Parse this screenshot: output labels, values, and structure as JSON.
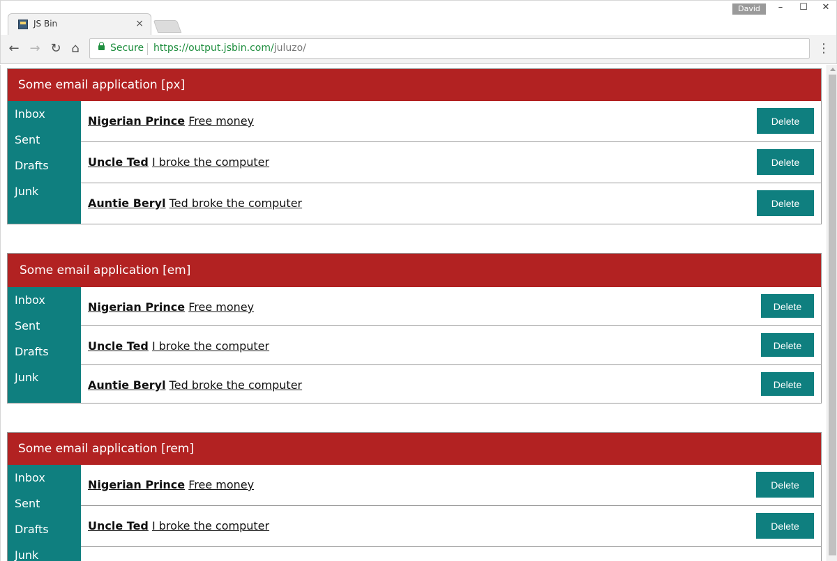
{
  "browser": {
    "tab_title": "JS Bin",
    "tab_close": "×",
    "user_badge": "David",
    "window_controls": {
      "minimize": "–",
      "maximize": "☐",
      "close": "✕"
    },
    "nav": {
      "back": "←",
      "forward": "→",
      "reload": "↻",
      "home": "⌂",
      "menu": "⋮"
    },
    "security_label": "Secure",
    "url_host": "https://output.jsbin.com/",
    "url_path": "juluzo/",
    "icons": [
      "favicon-icon",
      "close-icon",
      "back-icon",
      "forward-icon",
      "reload-icon",
      "home-icon",
      "lock-icon",
      "menu-icon"
    ]
  },
  "apps": [
    {
      "title": "Some email application [px]",
      "sidebar": [
        "Inbox",
        "Sent",
        "Drafts",
        "Junk"
      ],
      "emails": [
        {
          "sender": "Nigerian Prince",
          "subject": "Free money",
          "action": "Delete"
        },
        {
          "sender": "Uncle Ted",
          "subject": "I broke the computer",
          "action": "Delete"
        },
        {
          "sender": "Auntie Beryl",
          "subject": "Ted broke the computer",
          "action": "Delete"
        }
      ]
    },
    {
      "title": "Some email application [em]",
      "sidebar": [
        "Inbox",
        "Sent",
        "Drafts",
        "Junk"
      ],
      "emails": [
        {
          "sender": "Nigerian Prince",
          "subject": "Free money",
          "action": "Delete"
        },
        {
          "sender": "Uncle Ted",
          "subject": "I broke the computer",
          "action": "Delete"
        },
        {
          "sender": "Auntie Beryl",
          "subject": "Ted broke the computer",
          "action": "Delete"
        }
      ]
    },
    {
      "title": "Some email application [rem]",
      "sidebar": [
        "Inbox",
        "Sent",
        "Drafts",
        "Junk"
      ],
      "emails": [
        {
          "sender": "Nigerian Prince",
          "subject": "Free money",
          "action": "Delete"
        },
        {
          "sender": "Uncle Ted",
          "subject": "I broke the computer",
          "action": "Delete"
        }
      ]
    }
  ],
  "colors": {
    "header": "#b22222",
    "accent": "#0f7f7f",
    "secure_green": "#1e8e3e"
  }
}
